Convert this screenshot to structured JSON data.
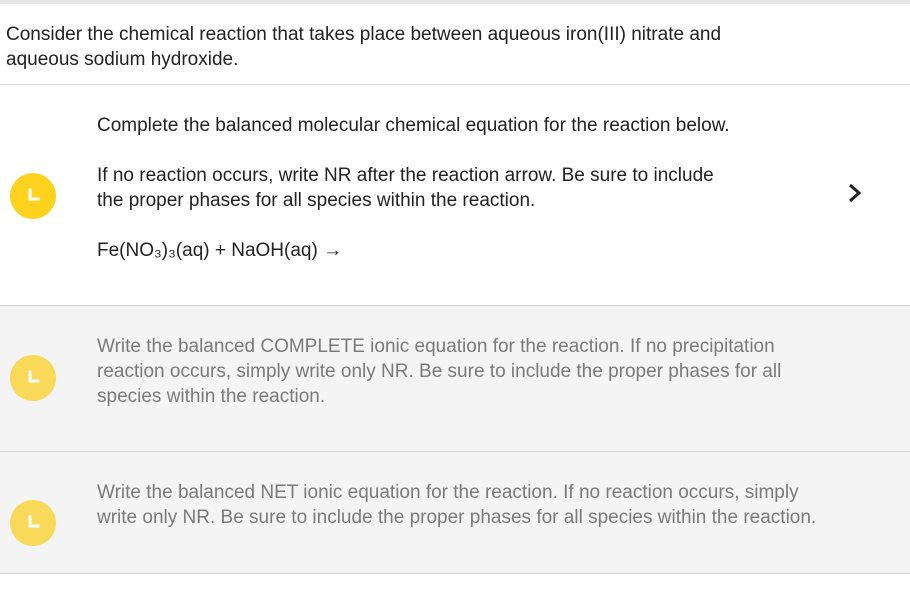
{
  "prompt": {
    "line1": "Consider the chemical reaction that takes place between aqueous iron(III) nitrate and",
    "line2": "aqueous sodium hydroxide."
  },
  "parts": [
    {
      "state": "active",
      "instruction": "Complete the balanced molecular chemical equation for the reaction below.",
      "note_line1": "If no reaction occurs, write NR after the reaction arrow. Be sure to include",
      "note_line2": "the proper phases for all species within the reaction.",
      "equation": "Fe(NO₃)₃(aq) + NaOH(aq) →",
      "icon": "clock-icon",
      "action_icon": "chevron-right-icon"
    },
    {
      "state": "inactive",
      "line1": "Write the balanced COMPLETE ionic equation for the reaction. If no precipitation",
      "line2": "reaction occurs, simply write only NR. Be sure to include the proper phases for all",
      "line3": "species within the reaction.",
      "icon": "clock-icon"
    },
    {
      "state": "inactive",
      "line1": "Write the balanced NET ionic equation for the reaction. If no reaction occurs, simply",
      "line2": "write only NR. Be sure to include the proper phases for all species within the reaction.",
      "icon": "clock-icon"
    }
  ],
  "colors": {
    "badge_active": "#ffd21f",
    "badge_inactive": "#f9d95a",
    "inactive_text": "#7a7a7a"
  }
}
